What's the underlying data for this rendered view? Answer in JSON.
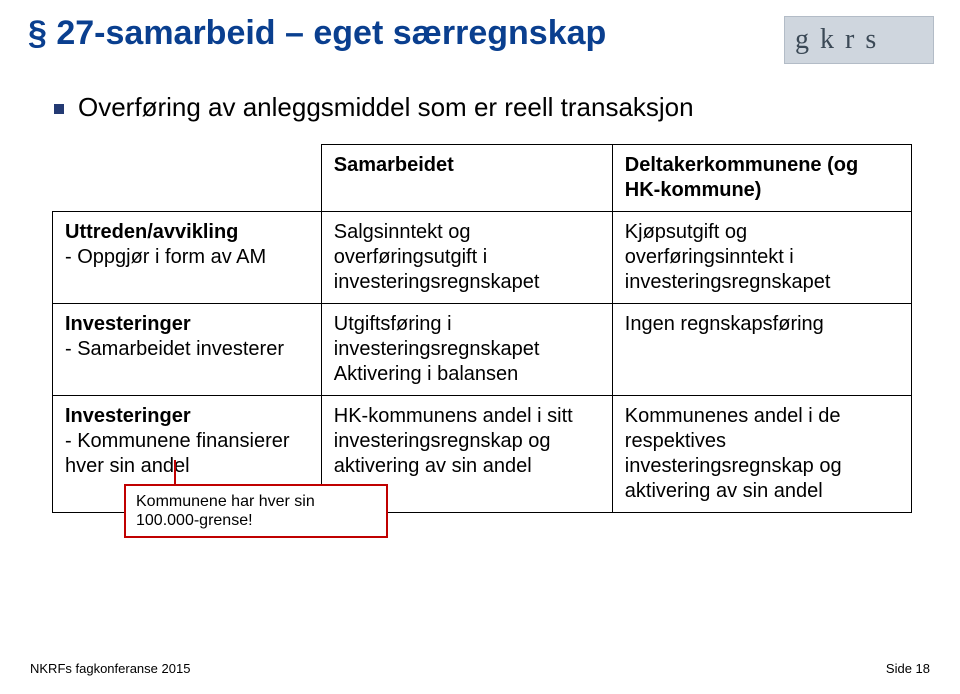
{
  "logo_text": "g k r s",
  "title": "§ 27-samarbeid – eget særregnskap",
  "bullet": "Overføring av anleggsmiddel som er reell transaksjon",
  "table": {
    "head_col2": "Samarbeidet",
    "head_col3": "Deltakerkommunene (og HK-kommune)",
    "rows": [
      {
        "head_line1": "Uttreden/avvikling",
        "head_line2": "- Oppgjør i form av AM",
        "c2": "Salgsinntekt og overføringsutgift i investeringsregnskapet",
        "c3": "Kjøpsutgift og overføringsinntekt i investeringsregnskapet"
      },
      {
        "head_line1": "Investeringer",
        "head_line2": "- Samarbeidet investerer",
        "c2": "Utgiftsføring i investeringsregnskapet Aktivering i balansen",
        "c3": "Ingen regnskapsføring"
      },
      {
        "head_line1": "Investeringer",
        "head_line2": "- Kommunene finansierer hver sin andel",
        "c2": "HK-kommunens andel i sitt investeringsregnskap og aktivering av sin andel",
        "c3": "Kommunenes andel i de respektives investeringsregnskap og aktivering av sin andel"
      }
    ]
  },
  "callout": "Kommunene har hver sin 100.000-grense!",
  "footer_left": "NKRFs fagkonferanse 2015",
  "footer_right": "Side 18"
}
